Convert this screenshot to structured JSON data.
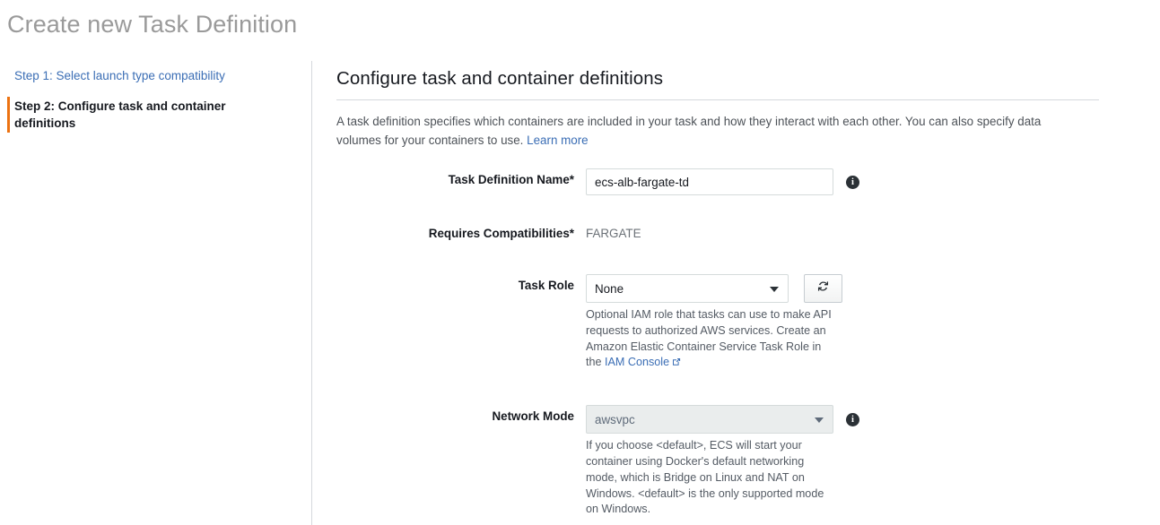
{
  "page": {
    "title": "Create new Task Definition"
  },
  "sidebar": {
    "steps": [
      {
        "label": "Step 1: Select launch type compatibility",
        "state": "link"
      },
      {
        "label": "Step 2: Configure task and container definitions",
        "state": "current"
      }
    ]
  },
  "content": {
    "heading": "Configure task and container definitions",
    "description": "A task definition specifies which containers are included in your task and how they interact with each other. You can also specify data volumes for your containers to use.",
    "learn_more_label": "Learn more"
  },
  "form": {
    "task_definition_name": {
      "label": "Task Definition Name*",
      "value": "ecs-alb-fargate-td",
      "placeholder": "",
      "info_icon": "info-icon"
    },
    "requires_compatibilities": {
      "label": "Requires Compatibilities*",
      "value": "FARGATE"
    },
    "task_role": {
      "label": "Task Role",
      "selected": "None",
      "options": [
        "None"
      ],
      "refresh_icon": "refresh-icon",
      "helper_text": "Optional IAM role that tasks can use to make API requests to authorized AWS services. Create an Amazon Elastic Container Service Task Role in the",
      "helper_link_label": "IAM Console",
      "helper_link_icon": "external-link-icon"
    },
    "network_mode": {
      "label": "Network Mode",
      "selected": "awsvpc",
      "options": [
        "awsvpc"
      ],
      "disabled": true,
      "info_icon": "info-icon",
      "helper_text": "If you choose <default>, ECS will start your container using Docker's default networking mode, which is Bridge on Linux and NAT on Windows. <default> is the only supported mode on Windows."
    }
  },
  "colors": {
    "accent_orange": "#ec7211",
    "link_blue": "#3b6eb5",
    "title_grey": "#9a9a9a",
    "text_dark": "#16191f",
    "helper_grey": "#545b64",
    "border_grey": "#d5dbdb",
    "disabled_bg": "#eaeded"
  }
}
